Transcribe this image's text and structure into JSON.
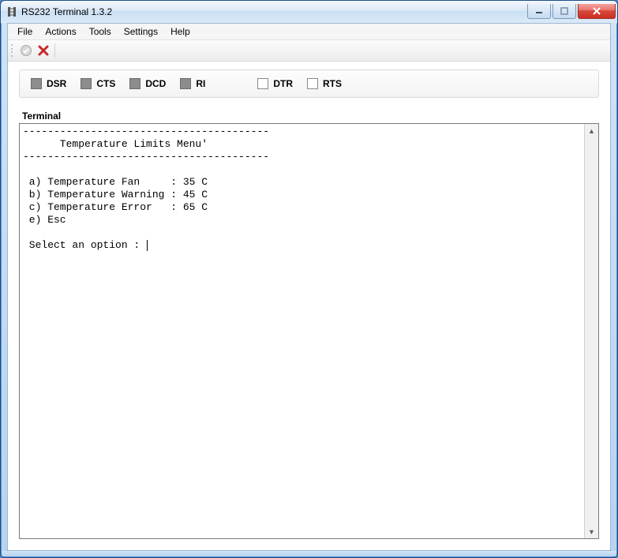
{
  "window": {
    "title": "RS232 Terminal 1.3.2"
  },
  "menubar": {
    "file": "File",
    "actions": "Actions",
    "tools": "Tools",
    "settings": "Settings",
    "help": "Help"
  },
  "signals": {
    "dsr": "DSR",
    "cts": "CTS",
    "dcd": "DCD",
    "ri": "RI",
    "dtr": "DTR",
    "rts": "RTS"
  },
  "terminal": {
    "group_label": "Terminal",
    "content": "----------------------------------------\n      Temperature Limits Menu'\n----------------------------------------\n\n a) Temperature Fan     : 35 C\n b) Temperature Warning : 45 C\n c) Temperature Error   : 65 C\n e) Esc\n\n Select an option : "
  }
}
